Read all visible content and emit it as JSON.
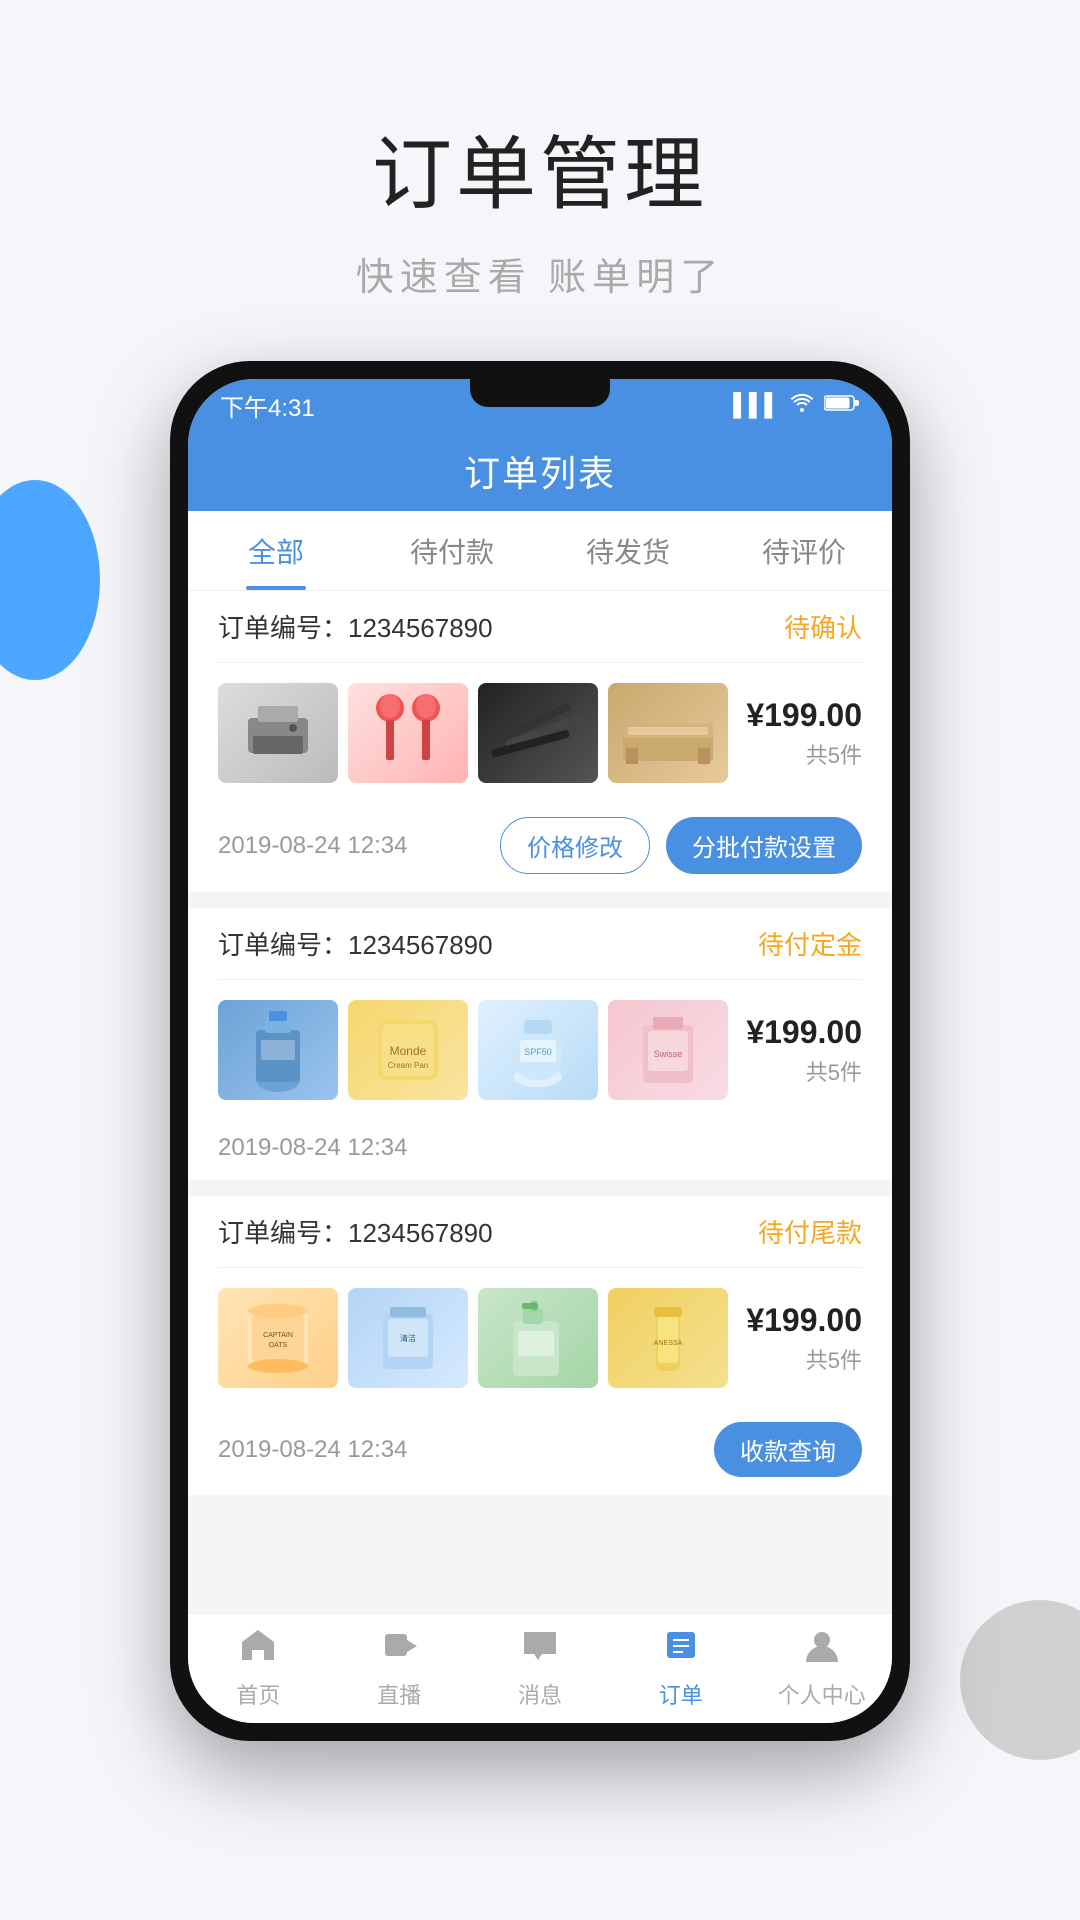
{
  "page": {
    "title": "订单管理",
    "subtitle": "快速查看 账单明了"
  },
  "status_bar": {
    "time": "下午4:31",
    "signal": "📶",
    "wifi": "WiFi",
    "battery": "Battery"
  },
  "app": {
    "header_title": "订单列表"
  },
  "tabs": [
    {
      "label": "全部",
      "active": true
    },
    {
      "label": "待付款",
      "active": false
    },
    {
      "label": "待发货",
      "active": false
    },
    {
      "label": "待评价",
      "active": false
    }
  ],
  "orders": [
    {
      "id": "order-1",
      "number_label": "订单编号：",
      "number": "1234567890",
      "status": "待确认",
      "price": "¥199.00",
      "count": "共5件",
      "date": "2019-08-24 12:34",
      "buttons": [
        {
          "label": "价格修改",
          "type": "outline"
        },
        {
          "label": "分批付款设置",
          "type": "solid"
        }
      ]
    },
    {
      "id": "order-2",
      "number_label": "订单编号：",
      "number": "1234567890",
      "status": "待付定金",
      "price": "¥199.00",
      "count": "共5件",
      "date": "2019-08-24 12:34",
      "buttons": []
    },
    {
      "id": "order-3",
      "number_label": "订单编号：",
      "number": "1234567890",
      "status": "待付尾款",
      "price": "¥199.00",
      "count": "共5件",
      "date": "2019-08-24 12:34",
      "buttons": [
        {
          "label": "收款查询",
          "type": "solid"
        }
      ]
    }
  ],
  "bottom_nav": [
    {
      "label": "首页",
      "icon": "⌂",
      "active": false
    },
    {
      "label": "直播",
      "icon": "▶",
      "active": false
    },
    {
      "label": "消息",
      "icon": "💬",
      "active": false
    },
    {
      "label": "订单",
      "icon": "≡",
      "active": true
    },
    {
      "label": "个人中心",
      "icon": "👤",
      "active": false
    }
  ]
}
